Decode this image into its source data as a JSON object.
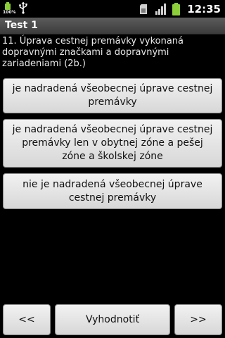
{
  "status_bar": {
    "battery_percent_label": "100%",
    "time": "12:35",
    "battery_color": "#8ccf3a",
    "icons": [
      "battery-icon",
      "usb-icon",
      "sd-card-icon",
      "signal-icon",
      "battery-icon"
    ]
  },
  "title": "Test 1",
  "question": "11. Úprava cestnej premávky vykonaná dopravnými značkami a dopravnými zariadeniami  (2b.)",
  "answers": [
    {
      "label": "je nadradená všeobecnej úprave cestnej premávky"
    },
    {
      "label": "je nadradená všeobecnej úprave cestnej premávky len v obytnej zóne a pešej zóne a školskej zóne"
    },
    {
      "label": "nie je nadradená všeobecnej úprave cestnej premávky"
    }
  ],
  "bottom_bar": {
    "prev_label": "<<",
    "evaluate_label": "Vyhodnotiť",
    "next_label": ">>"
  }
}
